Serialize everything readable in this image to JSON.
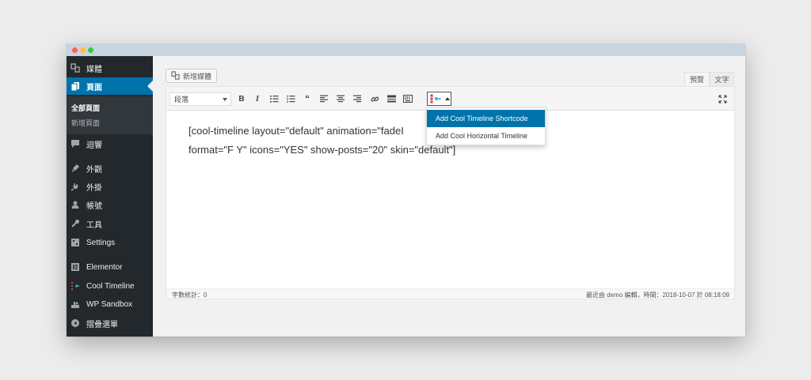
{
  "sidebar": {
    "items": [
      {
        "label": "媒體",
        "icon": "media-icon"
      },
      {
        "label": "頁面",
        "icon": "pages-icon",
        "active": true
      },
      {
        "label": "迴響",
        "icon": "comments-icon"
      },
      {
        "label": "外觀",
        "icon": "appearance-icon"
      },
      {
        "label": "外掛",
        "icon": "plugins-icon"
      },
      {
        "label": "帳號",
        "icon": "users-icon"
      },
      {
        "label": "工具",
        "icon": "tools-icon"
      },
      {
        "label": "Settings",
        "icon": "settings-icon"
      },
      {
        "label": "Elementor",
        "icon": "elementor-icon"
      },
      {
        "label": "Cool Timeline",
        "icon": "timeline-icon"
      },
      {
        "label": "WP Sandbox",
        "icon": "sandbox-icon"
      },
      {
        "label": "摺疊選單",
        "icon": "collapse-icon"
      }
    ],
    "submenu": [
      "全部頁面",
      "新增頁面"
    ]
  },
  "editor": {
    "add_media_label": "新增媒體",
    "tab_visual": "預覽",
    "tab_text": "文字",
    "format_select_value": "段落",
    "content_line1": "[cool-timeline layout=\"default\" animation=\"fadeI",
    "content_line2": "format=\"F Y\" icons=\"YES\" show-posts=\"20\" skin=\"default\"]",
    "word_count": "字數統計：0",
    "last_edited": "最近由 demo 編輯，時間：2018-10-07 於 08:18:09"
  },
  "dropdown": {
    "items": [
      "Add Cool Timeline Shortcode",
      "Add Cool Horizontal Timeline"
    ]
  },
  "colors": {
    "sidebar_bg": "#23282d",
    "accent": "#0073aa",
    "titlebar": "#c8d4de"
  }
}
